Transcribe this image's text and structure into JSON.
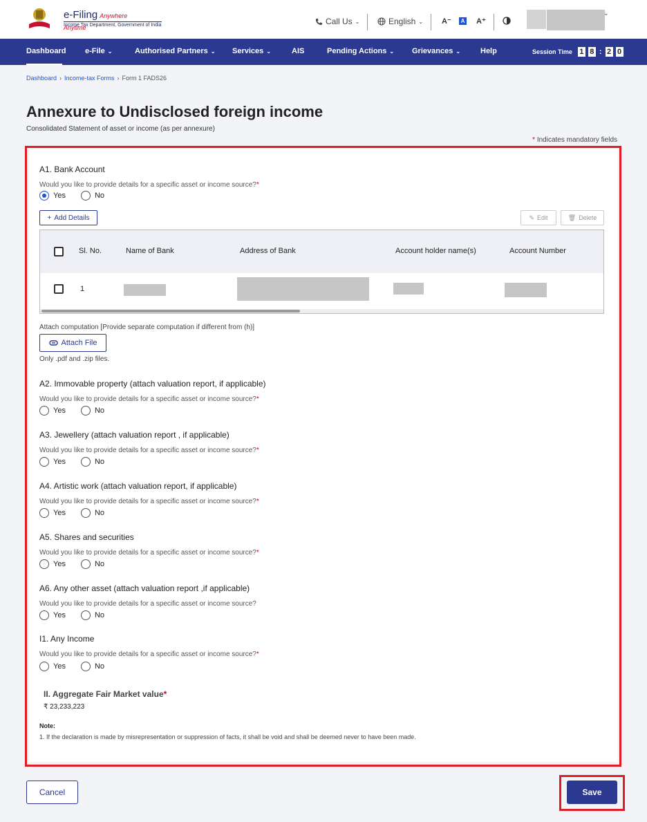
{
  "header": {
    "logo_title": "e-Filing",
    "logo_tagline": "Anywhere Anytime",
    "logo_subtitle": "Income Tax Department, Government of India",
    "call_us": "Call Us",
    "language": "English",
    "font_decrease": "A⁻",
    "font_default": "A",
    "font_increase": "A⁺",
    "contrast_icon": "contrast-icon"
  },
  "nav": {
    "items": [
      {
        "label": "Dashboard",
        "has_menu": false
      },
      {
        "label": "e-File",
        "has_menu": true
      },
      {
        "label": "Authorised Partners",
        "has_menu": true
      },
      {
        "label": "Services",
        "has_menu": true
      },
      {
        "label": "AIS",
        "has_menu": false
      },
      {
        "label": "Pending Actions",
        "has_menu": true
      },
      {
        "label": "Grievances",
        "has_menu": true
      },
      {
        "label": "Help",
        "has_menu": false
      }
    ],
    "session_label": "Session Time",
    "session_digits": [
      "1",
      "8",
      "2",
      "0"
    ]
  },
  "breadcrumb": {
    "items": [
      "Dashboard",
      "Income-tax Forms",
      "Form 1 FADS26"
    ]
  },
  "page": {
    "title": "Annexure to Undisclosed foreign income",
    "subtitle": "Consolidated Statement of asset or income (as per annexure)",
    "mandatory_note": "Indicates mandatory fields",
    "asterisk": "*"
  },
  "question": "Would you like to provide details for a specific asset or income source?",
  "yes_label": "Yes",
  "no_label": "No",
  "sections": [
    {
      "title": "A1. Bank Account",
      "required": true,
      "selected": "yes"
    },
    {
      "title": "A2. Immovable property (attach valuation report, if applicable)",
      "required": true,
      "selected": null
    },
    {
      "title": "A3. Jewellery (attach valuation report , if applicable)",
      "required": true,
      "selected": null
    },
    {
      "title": "A4. Artistic work (attach valuation report, if applicable)",
      "required": true,
      "selected": null
    },
    {
      "title": "A5. Shares and securities",
      "required": true,
      "selected": null
    },
    {
      "title": "A6. Any other asset (attach valuation report ,if applicable)",
      "required": false,
      "selected": null
    },
    {
      "title": "I1.  Any Income",
      "required": true,
      "selected": null
    }
  ],
  "bank_table": {
    "add_label": "Add Details",
    "edit_label": "Edit",
    "delete_label": "Delete",
    "columns": [
      "Sl. No.",
      "Name of Bank",
      "Address of Bank",
      "Account holder name(s)",
      "Account Number"
    ],
    "rows": [
      {
        "sl_no": "1"
      }
    ]
  },
  "attach": {
    "label": "Attach computation [Provide separate computation if different from (h)]",
    "button": "Attach File",
    "hint": "Only .pdf and .zip files."
  },
  "aggregate": {
    "title": "II. Aggregate Fair Market value",
    "value": "₹ 23,233,223"
  },
  "note": {
    "title": "Note:",
    "text": "1. If the declaration is made by misrepresentation or suppression of facts, it shall be void and shall be deemed never to have been made."
  },
  "actions": {
    "cancel": "Cancel",
    "save": "Save"
  },
  "colors": {
    "nav_bg": "#2b3990",
    "accent": "#1a56db",
    "highlight": "#e01b24"
  }
}
